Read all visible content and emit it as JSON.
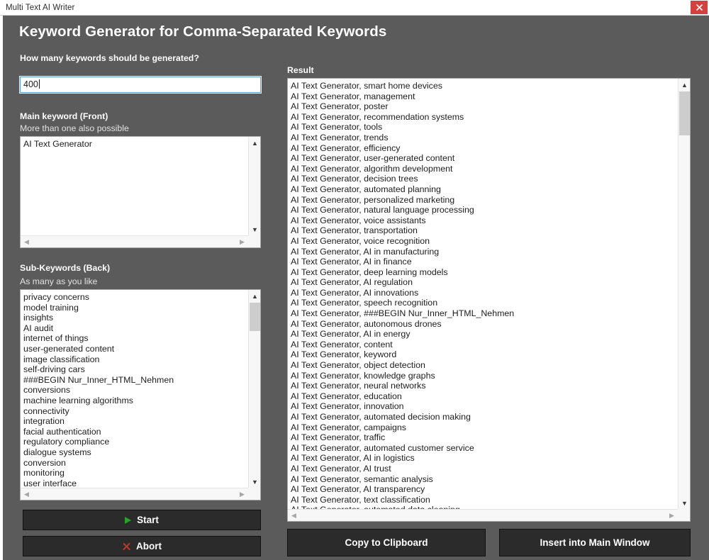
{
  "window": {
    "title": "Multi Text AI Writer",
    "close_icon": "close-icon"
  },
  "heading": "Keyword Generator for Comma-Separated Keywords",
  "form": {
    "count_label": "How many keywords should be generated?",
    "count_value": "400",
    "count_placeholder": "",
    "main_keyword": {
      "label": "Main keyword (Front)",
      "sublabel": "More than one also possible",
      "lines": [
        "AI Text Generator"
      ]
    },
    "sub_keywords": {
      "label": "Sub-Keywords (Back)",
      "sublabel": "As many as you like",
      "lines": [
        "privacy concerns",
        "model training",
        "insights",
        "AI audit",
        "internet of things",
        "user-generated content",
        "image classification",
        "self-driving cars",
        "###BEGIN Nur_Inner_HTML_Nehmen",
        "conversions",
        "machine learning algorithms",
        "connectivity",
        "integration",
        "facial authentication",
        "regulatory compliance",
        "dialogue systems",
        "conversion",
        "monitoring",
        "user interface"
      ]
    }
  },
  "buttons": {
    "start": "Start",
    "abort": "Abort",
    "copy_to_clipboard": "Copy to Clipboard",
    "insert_into_main_window": "Insert into Main Window",
    "start_icon": "play-icon",
    "abort_icon": "x-icon"
  },
  "result": {
    "label": "Result",
    "lines": [
      "AI Text Generator, smart home devices",
      "AI Text Generator, management",
      "AI Text Generator, poster",
      "AI Text Generator, recommendation systems",
      "AI Text Generator, tools",
      "AI Text Generator, trends",
      "AI Text Generator, efficiency",
      "AI Text Generator, user-generated content",
      "AI Text Generator, algorithm development",
      "AI Text Generator, decision trees",
      "AI Text Generator, automated planning",
      "AI Text Generator, personalized marketing",
      "AI Text Generator, natural language processing",
      "AI Text Generator, voice assistants",
      "AI Text Generator, transportation",
      "AI Text Generator, voice recognition",
      "AI Text Generator, AI in manufacturing",
      "AI Text Generator, AI in finance",
      "AI Text Generator, deep learning models",
      "AI Text Generator, AI regulation",
      "AI Text Generator, AI innovations",
      "AI Text Generator, speech recognition",
      "AI Text Generator, ###BEGIN Nur_Inner_HTML_Nehmen",
      "AI Text Generator, autonomous drones",
      "AI Text Generator, AI in energy",
      "AI Text Generator, content",
      "AI Text Generator, keyword",
      "AI Text Generator, object detection",
      "AI Text Generator, knowledge graphs",
      "AI Text Generator, neural networks",
      "AI Text Generator, education",
      "AI Text Generator, innovation",
      "AI Text Generator, automated decision making",
      "AI Text Generator, campaigns",
      "AI Text Generator, traffic",
      "AI Text Generator, automated customer service",
      "AI Text Generator, AI in logistics",
      "AI Text Generator, AI trust",
      "AI Text Generator, semantic analysis",
      "AI Text Generator, AI transparency",
      "AI Text Generator, text classification",
      "AI Text Generator, automated data cleaning"
    ]
  },
  "colors": {
    "window_background": "#5b5b5b",
    "button_background": "#2b2b2b",
    "close_button": "#d44040",
    "focus_border": "#5a9fd4",
    "start_icon": "#2ca02c",
    "abort_icon": "#c0392b"
  }
}
